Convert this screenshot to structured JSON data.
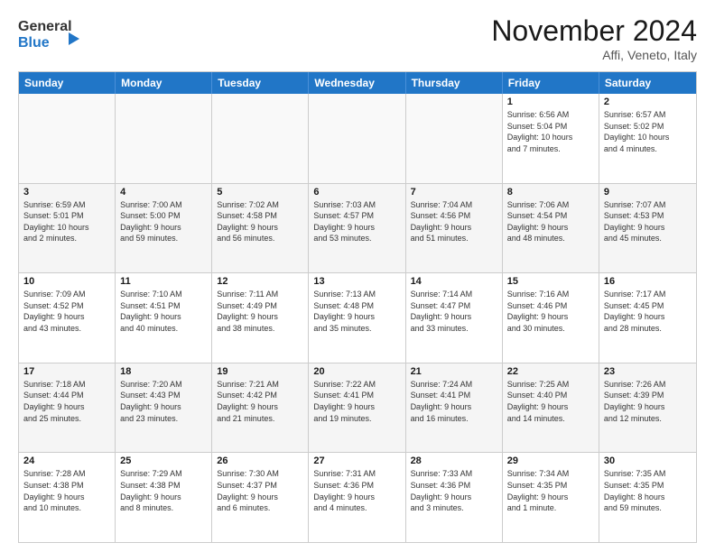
{
  "logo": {
    "line1": "General",
    "line2": "Blue"
  },
  "title": "November 2024",
  "location": "Affi, Veneto, Italy",
  "weekdays": [
    "Sunday",
    "Monday",
    "Tuesday",
    "Wednesday",
    "Thursday",
    "Friday",
    "Saturday"
  ],
  "rows": [
    [
      {
        "day": "",
        "text": ""
      },
      {
        "day": "",
        "text": ""
      },
      {
        "day": "",
        "text": ""
      },
      {
        "day": "",
        "text": ""
      },
      {
        "day": "",
        "text": ""
      },
      {
        "day": "1",
        "text": "Sunrise: 6:56 AM\nSunset: 5:04 PM\nDaylight: 10 hours\nand 7 minutes."
      },
      {
        "day": "2",
        "text": "Sunrise: 6:57 AM\nSunset: 5:02 PM\nDaylight: 10 hours\nand 4 minutes."
      }
    ],
    [
      {
        "day": "3",
        "text": "Sunrise: 6:59 AM\nSunset: 5:01 PM\nDaylight: 10 hours\nand 2 minutes."
      },
      {
        "day": "4",
        "text": "Sunrise: 7:00 AM\nSunset: 5:00 PM\nDaylight: 9 hours\nand 59 minutes."
      },
      {
        "day": "5",
        "text": "Sunrise: 7:02 AM\nSunset: 4:58 PM\nDaylight: 9 hours\nand 56 minutes."
      },
      {
        "day": "6",
        "text": "Sunrise: 7:03 AM\nSunset: 4:57 PM\nDaylight: 9 hours\nand 53 minutes."
      },
      {
        "day": "7",
        "text": "Sunrise: 7:04 AM\nSunset: 4:56 PM\nDaylight: 9 hours\nand 51 minutes."
      },
      {
        "day": "8",
        "text": "Sunrise: 7:06 AM\nSunset: 4:54 PM\nDaylight: 9 hours\nand 48 minutes."
      },
      {
        "day": "9",
        "text": "Sunrise: 7:07 AM\nSunset: 4:53 PM\nDaylight: 9 hours\nand 45 minutes."
      }
    ],
    [
      {
        "day": "10",
        "text": "Sunrise: 7:09 AM\nSunset: 4:52 PM\nDaylight: 9 hours\nand 43 minutes."
      },
      {
        "day": "11",
        "text": "Sunrise: 7:10 AM\nSunset: 4:51 PM\nDaylight: 9 hours\nand 40 minutes."
      },
      {
        "day": "12",
        "text": "Sunrise: 7:11 AM\nSunset: 4:49 PM\nDaylight: 9 hours\nand 38 minutes."
      },
      {
        "day": "13",
        "text": "Sunrise: 7:13 AM\nSunset: 4:48 PM\nDaylight: 9 hours\nand 35 minutes."
      },
      {
        "day": "14",
        "text": "Sunrise: 7:14 AM\nSunset: 4:47 PM\nDaylight: 9 hours\nand 33 minutes."
      },
      {
        "day": "15",
        "text": "Sunrise: 7:16 AM\nSunset: 4:46 PM\nDaylight: 9 hours\nand 30 minutes."
      },
      {
        "day": "16",
        "text": "Sunrise: 7:17 AM\nSunset: 4:45 PM\nDaylight: 9 hours\nand 28 minutes."
      }
    ],
    [
      {
        "day": "17",
        "text": "Sunrise: 7:18 AM\nSunset: 4:44 PM\nDaylight: 9 hours\nand 25 minutes."
      },
      {
        "day": "18",
        "text": "Sunrise: 7:20 AM\nSunset: 4:43 PM\nDaylight: 9 hours\nand 23 minutes."
      },
      {
        "day": "19",
        "text": "Sunrise: 7:21 AM\nSunset: 4:42 PM\nDaylight: 9 hours\nand 21 minutes."
      },
      {
        "day": "20",
        "text": "Sunrise: 7:22 AM\nSunset: 4:41 PM\nDaylight: 9 hours\nand 19 minutes."
      },
      {
        "day": "21",
        "text": "Sunrise: 7:24 AM\nSunset: 4:41 PM\nDaylight: 9 hours\nand 16 minutes."
      },
      {
        "day": "22",
        "text": "Sunrise: 7:25 AM\nSunset: 4:40 PM\nDaylight: 9 hours\nand 14 minutes."
      },
      {
        "day": "23",
        "text": "Sunrise: 7:26 AM\nSunset: 4:39 PM\nDaylight: 9 hours\nand 12 minutes."
      }
    ],
    [
      {
        "day": "24",
        "text": "Sunrise: 7:28 AM\nSunset: 4:38 PM\nDaylight: 9 hours\nand 10 minutes."
      },
      {
        "day": "25",
        "text": "Sunrise: 7:29 AM\nSunset: 4:38 PM\nDaylight: 9 hours\nand 8 minutes."
      },
      {
        "day": "26",
        "text": "Sunrise: 7:30 AM\nSunset: 4:37 PM\nDaylight: 9 hours\nand 6 minutes."
      },
      {
        "day": "27",
        "text": "Sunrise: 7:31 AM\nSunset: 4:36 PM\nDaylight: 9 hours\nand 4 minutes."
      },
      {
        "day": "28",
        "text": "Sunrise: 7:33 AM\nSunset: 4:36 PM\nDaylight: 9 hours\nand 3 minutes."
      },
      {
        "day": "29",
        "text": "Sunrise: 7:34 AM\nSunset: 4:35 PM\nDaylight: 9 hours\nand 1 minute."
      },
      {
        "day": "30",
        "text": "Sunrise: 7:35 AM\nSunset: 4:35 PM\nDaylight: 8 hours\nand 59 minutes."
      }
    ]
  ]
}
